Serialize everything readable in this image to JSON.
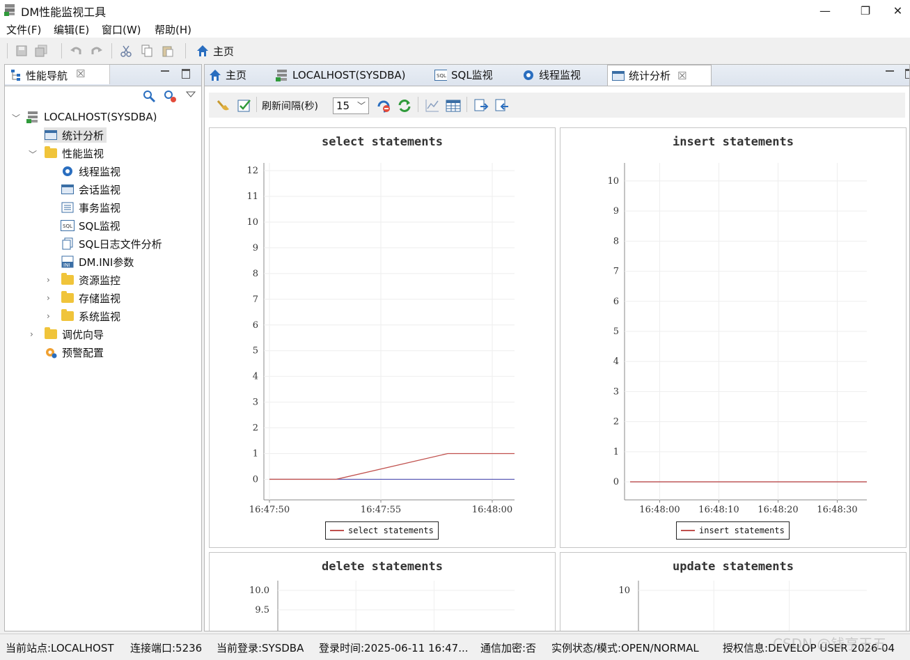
{
  "window": {
    "title": "DM性能监视工具",
    "controls": [
      "—",
      "❐",
      "✕"
    ]
  },
  "menubar": [
    "文件(F)",
    "编辑(E)",
    "窗口(W)",
    "帮助(H)"
  ],
  "toolbar": {
    "home_label": "主页"
  },
  "navigator": {
    "title": "性能导航",
    "close_glyph": "☒",
    "tree": {
      "root": "LOCALHOST(SYSDBA)",
      "stats": "统计分析",
      "perf_monitor": "性能监视",
      "perf_children": [
        "线程监视",
        "会话监视",
        "事务监视",
        "SQL监视",
        "SQL日志文件分析",
        "DM.INI参数"
      ],
      "folders": [
        "资源监控",
        "存储监视",
        "系统监视"
      ],
      "tuning": "调优向导",
      "alarm": "预警配置"
    }
  },
  "tabs": [
    {
      "label": "主页",
      "icon": "home-icon"
    },
    {
      "label": "LOCALHOST(SYSDBA)",
      "icon": "server-icon"
    },
    {
      "label": "SQL监视",
      "icon": "sql-icon"
    },
    {
      "label": "线程监视",
      "icon": "gear-icon"
    },
    {
      "label": "统计分析",
      "icon": "window-icon",
      "active": true
    }
  ],
  "stats_toolbar": {
    "interval_label": "刷新间隔(秒)",
    "interval_value": "15"
  },
  "colors": {
    "series_line": "#c0504d",
    "zero_line": "#4f4fb0",
    "accent": "#2a6ebf"
  },
  "chart_data": [
    {
      "type": "line",
      "title": "select statements",
      "x": [
        "16:47:50",
        "16:47:53",
        "16:47:58",
        "16:48:01"
      ],
      "series": [
        {
          "name": "select statements",
          "values": [
            0,
            0,
            1,
            1
          ]
        }
      ],
      "x_ticks": [
        "16:47:50",
        "16:47:55",
        "16:48:00"
      ],
      "y_ticks": [
        0,
        1,
        2,
        3,
        4,
        5,
        6,
        7,
        8,
        9,
        10,
        11,
        12
      ],
      "ylim": [
        -0.8,
        12.3
      ],
      "grid": true,
      "legend": "bottom-center"
    },
    {
      "type": "line",
      "title": "insert statements",
      "x": [
        "16:47:55",
        "16:48:35"
      ],
      "series": [
        {
          "name": "insert statements",
          "values": [
            0,
            0
          ]
        }
      ],
      "x_ticks": [
        "16:48:00",
        "16:48:10",
        "16:48:20",
        "16:48:30"
      ],
      "y_ticks": [
        0,
        1,
        2,
        3,
        4,
        5,
        6,
        7,
        8,
        9,
        10
      ],
      "ylim": [
        -0.6,
        10.6
      ],
      "grid": true,
      "legend": "bottom-center"
    },
    {
      "type": "line",
      "title": "delete statements",
      "y_ticks": [
        "10.0",
        "9.5"
      ],
      "grid": true
    },
    {
      "type": "line",
      "title": "update statements",
      "y_ticks": [
        "10"
      ],
      "grid": true
    }
  ],
  "statusbar": [
    "当前站点:LOCALHOST",
    "连接端口:5236",
    "当前登录:SYSDBA",
    "登录时间:2025-06-11 16:47...",
    "通信加密:否",
    "实例状态/模式:OPEN/NORMAL",
    "授权信息:DEVELOP USER 2026-04"
  ],
  "watermark": "CSDN @钱亨王五"
}
